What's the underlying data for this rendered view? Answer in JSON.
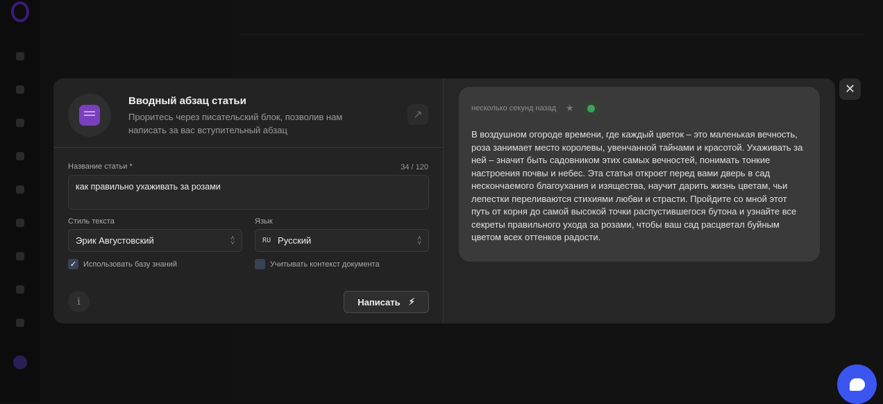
{
  "modal": {
    "title": "Вводный абзац статьи",
    "subtitle": "Проритесь через писательский блок, позволив нам написать за вас вступительный абзац",
    "article_label": "Название статьи *",
    "article_count": "34 / 120",
    "article_value": "как правильно ухаживать за розами",
    "style_label": "Стиль текста",
    "style_value": "Эрик Августовский",
    "lang_label": "Язык",
    "lang_code": "RU",
    "lang_value": "Русский",
    "kb_label": "Использовать базу знаний",
    "kb_checked": true,
    "ctx_label": "Учитывать контекст документа",
    "ctx_checked": false,
    "write_label": "Написать"
  },
  "result": {
    "timestamp": "несколько секунд назад",
    "text": "В воздушном огороде времени, где каждый цветок – это маленькая вечность, роза занимает место королевы, увенчанной тайнами и красотой. Ухаживать за ней – значит быть садовником этих самых вечностей, понимать тонкие настроения почвы и небес. Эта статья откроет перед вами дверь в сад нескончаемого благоухания и изящества, научит дарить жизнь цветам, чьи лепестки переливаются стихиями любви и страсти. Пройдите со мной этот путь от корня до самой высокой точки распустившегося бутона и узнайте все секреты правильного ухода за розами, чтобы ваш сад расцветал буйным цветом всех оттенков радости."
  },
  "colors": {
    "accent": "#7a3fbf",
    "chat": "#3b55f0",
    "success": "#3aa35a"
  }
}
